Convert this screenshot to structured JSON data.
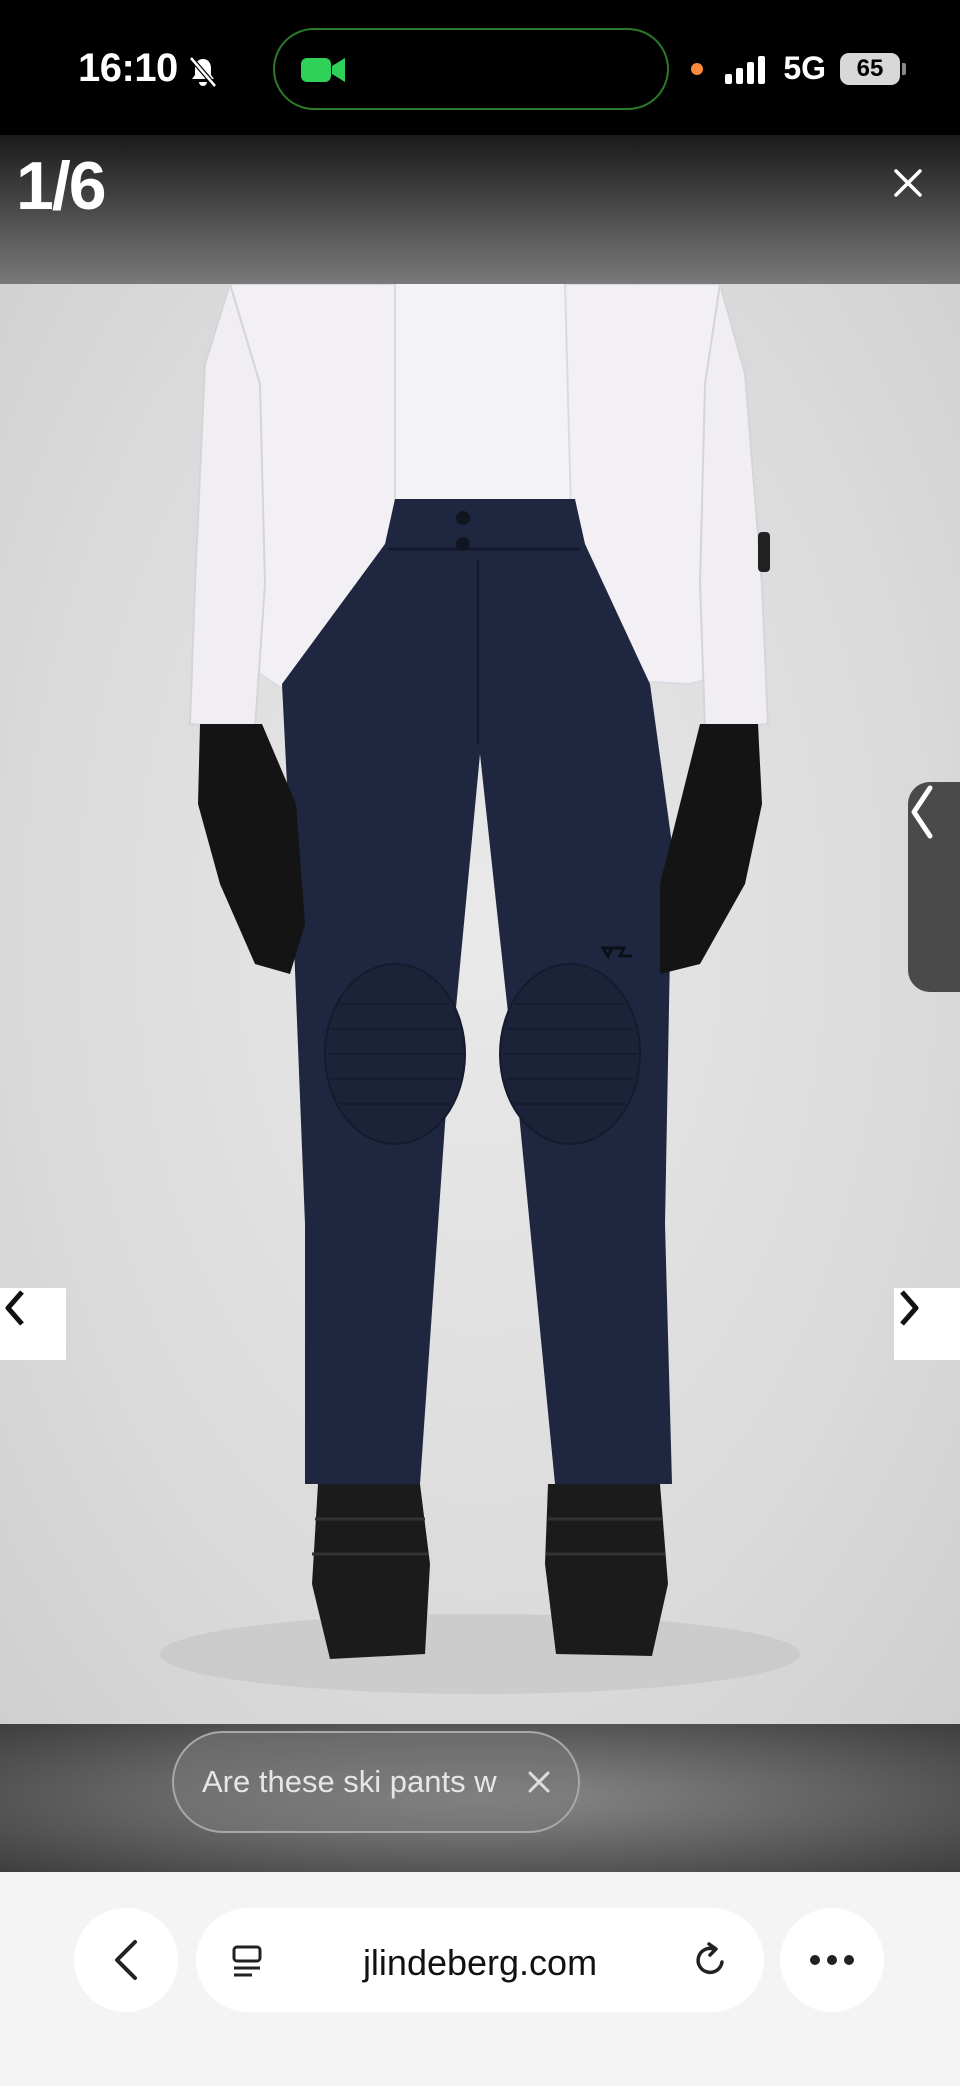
{
  "status_bar": {
    "time": "16:10",
    "network": "5G",
    "battery": "65",
    "colors": {
      "recording_dot": "#ff8a3d",
      "facetime_green": "#30d158"
    }
  },
  "viewer": {
    "counter": "1/6",
    "icons": {
      "close": "close-icon",
      "prev": "chevron-left-icon",
      "next": "chevron-right-icon",
      "side_tab": "chevron-left-icon"
    },
    "product_colors": {
      "pants": "#1f2740",
      "jacket": "#f2f0f4",
      "gloves": "#141414",
      "boots": "#1b1b1b"
    }
  },
  "assistant": {
    "question": "Are these ski pants w"
  },
  "browser": {
    "url": "jlindeberg.com",
    "icons": {
      "back": "chevron-left-icon",
      "reader": "reader-mode-icon",
      "reload": "reload-icon",
      "more": "more-dots-icon"
    }
  }
}
